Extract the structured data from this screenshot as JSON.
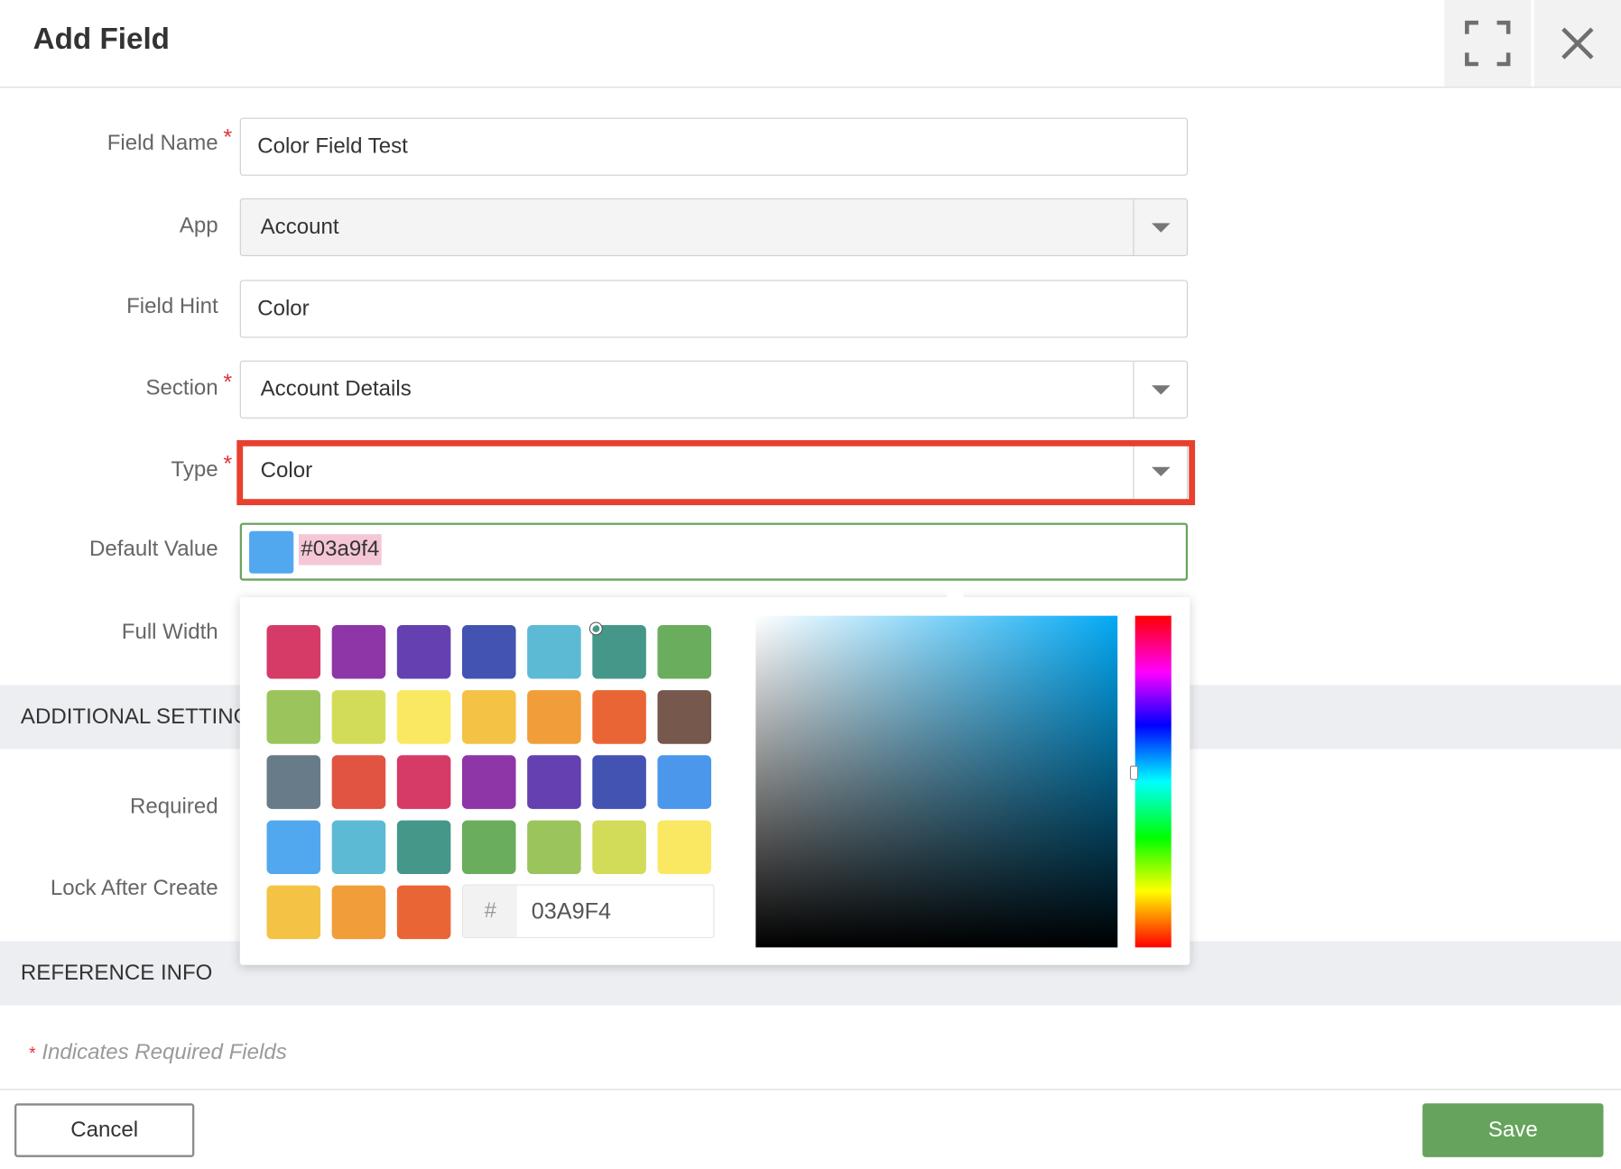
{
  "dialog": {
    "title": "Add Field"
  },
  "form": {
    "field_name": {
      "label": "Field Name",
      "value": "Color Field Test",
      "required_mark": "*"
    },
    "app": {
      "label": "App",
      "value": "Account"
    },
    "field_hint": {
      "label": "Field Hint",
      "value": "Color"
    },
    "section": {
      "label": "Section",
      "value": "Account Details",
      "required_mark": "*"
    },
    "type": {
      "label": "Type",
      "value": "Color",
      "required_mark": "*"
    },
    "default_value": {
      "label": "Default Value",
      "value": "#03a9f4"
    },
    "full_width": {
      "label": "Full Width"
    },
    "required": {
      "label": "Required"
    },
    "lock_after_create": {
      "label": "Lock After Create"
    }
  },
  "sections": {
    "additional_settings": "ADDITIONAL SETTINGS",
    "reference_info": "REFERENCE INFO"
  },
  "note": {
    "star": "*",
    "text": "Indicates Required Fields"
  },
  "buttons": {
    "cancel": "Cancel",
    "save": "Save"
  },
  "color_picker": {
    "hex_prefix": "#",
    "hex_value": "03A9F4",
    "selected_color": "#03a9f4",
    "swatches": [
      [
        "#d63a66",
        "#8e35a8",
        "#6440b1",
        "#4353b2",
        "#5dbad4",
        "#45978a",
        "#6aad5c"
      ],
      [
        "#9bc55c",
        "#d3dc59",
        "#fbe862",
        "#f4c244",
        "#f19d39",
        "#ea6535",
        "#76584c"
      ],
      [
        "#687b89",
        "#e05441",
        "#d63a66",
        "#8e35a8",
        "#6440b1",
        "#4353b2",
        "#4a97ec"
      ],
      [
        "#52a8ef",
        "#5dbad4",
        "#45978a",
        "#6aad5c",
        "#9bc55c",
        "#d3dc59",
        "#fbe862"
      ],
      [
        "#f4c244",
        "#f19d39",
        "#ea6535"
      ]
    ]
  }
}
